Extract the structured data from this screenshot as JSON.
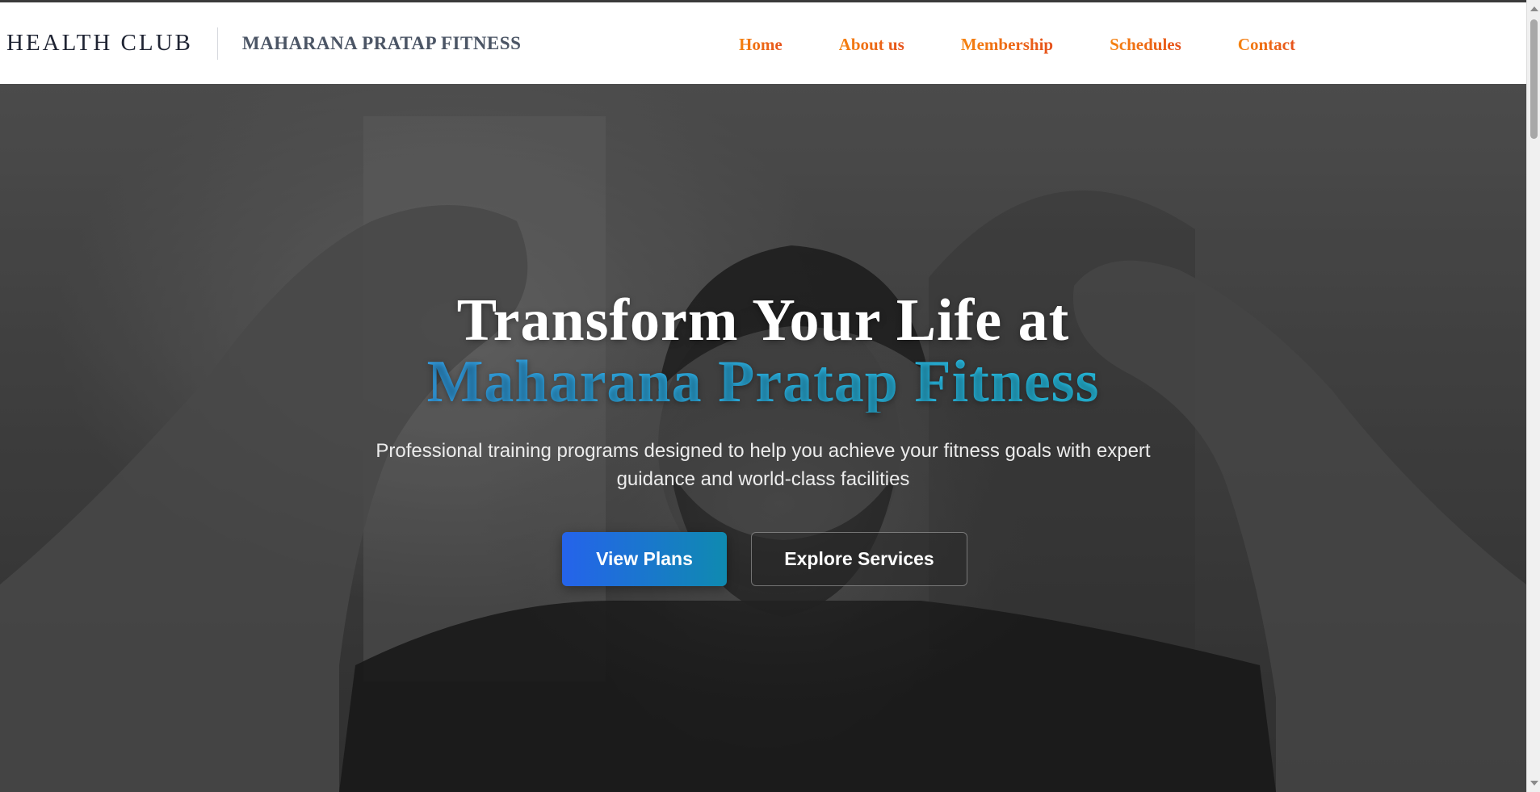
{
  "brand": {
    "club": "HEALTH CLUB",
    "name": "MAHARANA PRATAP FITNESS"
  },
  "nav": {
    "items": [
      {
        "label": "Home"
      },
      {
        "label": "About us"
      },
      {
        "label": "Membership"
      },
      {
        "label": "Schedules"
      },
      {
        "label": "Contact"
      }
    ]
  },
  "hero": {
    "title_line1": "Transform Your Life at",
    "title_line2": "Maharana Pratap Fitness",
    "subtitle": "Professional training programs designed to help you achieve your fitness goals with expert guidance and world-class facilities",
    "primary_button": "View Plans",
    "secondary_button": "Explore Services"
  },
  "colors": {
    "nav_gradient_start": "#f5830f",
    "nav_gradient_end": "#e6521c",
    "accent_blue": "#3f8cf0",
    "accent_cyan": "#22d2e6",
    "primary_button_start": "#2563eb",
    "primary_button_end": "#0f8ab0"
  },
  "icons": {
    "scroll_up": "scroll-up-arrow-icon",
    "scroll_down": "scroll-down-arrow-icon"
  }
}
